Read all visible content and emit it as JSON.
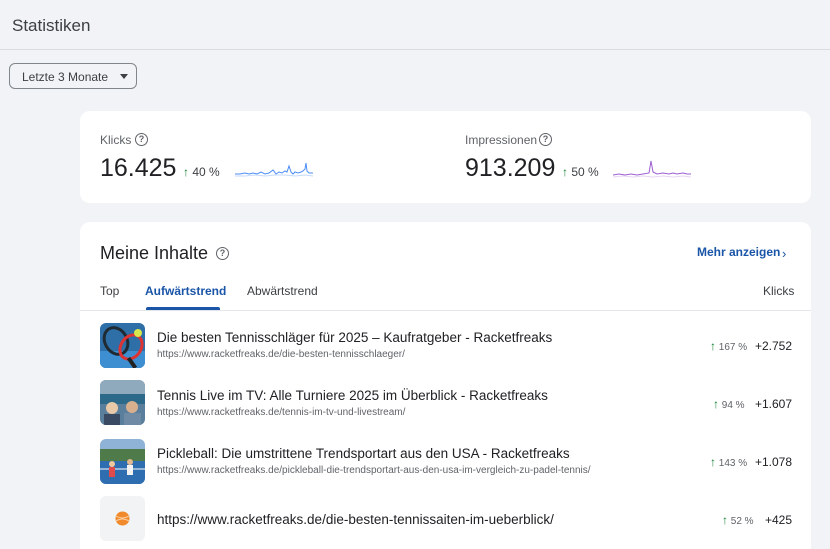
{
  "header": {
    "title": "Statistiken"
  },
  "date_range": {
    "selected": "Letzte 3 Monate"
  },
  "stats": {
    "clicks": {
      "label": "Klicks",
      "value": "16.425",
      "change": "40 %"
    },
    "impressions": {
      "label": "Impressionen",
      "value": "913.209",
      "change": "50 %"
    }
  },
  "content": {
    "title": "Meine Inhalte",
    "more_link": "Mehr anzeigen",
    "tabs": [
      {
        "label": "Top"
      },
      {
        "label": "Aufwärtstrend"
      },
      {
        "label": "Abwärtstrend"
      }
    ],
    "column_header": "Klicks",
    "rows": [
      {
        "title": "Die besten Tennisschläger für 2025 – Kaufratgeber - Racketfreaks",
        "url": "https://www.racketfreaks.de/die-besten-tennisschlaeger/",
        "change": "167 %",
        "clicks": "+2.752"
      },
      {
        "title": "Tennis Live im TV: Alle Turniere 2025 im Überblick - Racketfreaks",
        "url": "https://www.racketfreaks.de/tennis-im-tv-und-livestream/",
        "change": "94 %",
        "clicks": "+1.607"
      },
      {
        "title": "Pickleball: Die umstrittene Trendsportart aus den USA - Racketfreaks",
        "url": "https://www.racketfreaks.de/pickleball-die-trendsportart-aus-den-usa-im-vergleich-zu-padel-tennis/",
        "change": "143 %",
        "clicks": "+1.078"
      },
      {
        "title": "https://www.racketfreaks.de/die-besten-tennissaiten-im-ueberblick/",
        "url": "",
        "change": "52 %",
        "clicks": "+425"
      }
    ]
  },
  "colors": {
    "accent": "#1a55a8",
    "trend_up": "#188038",
    "clicks_sparkline": "#4c8df6",
    "impressions_sparkline": "#9c5fd3"
  },
  "icons": [
    "chevron-down-icon",
    "help-icon",
    "arrow-up-icon",
    "chevron-right-icon",
    "tennis-ball-icon"
  ]
}
